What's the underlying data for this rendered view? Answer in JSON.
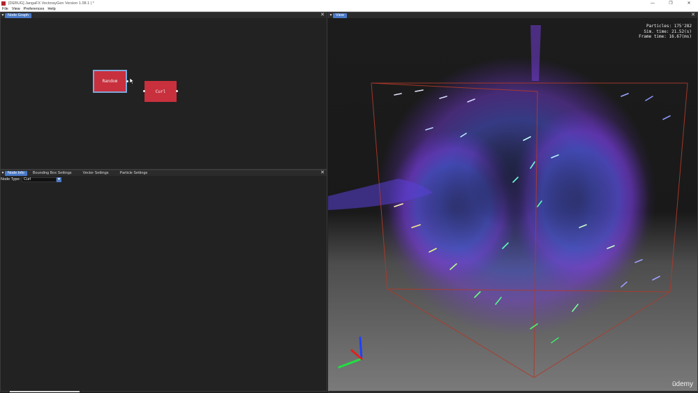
{
  "window": {
    "title": "[DEBUG] JangaFX VectorayGen Version 1.08.1 | *",
    "controls": [
      "—",
      "❐",
      "✕"
    ]
  },
  "menu": [
    "File",
    "View",
    "Preferences",
    "Help"
  ],
  "node_graph": {
    "tab_label": "Node Graph",
    "close": "✕",
    "nodes": {
      "random": "Random",
      "curl": "Curl"
    }
  },
  "bottom_panel": {
    "tabs": [
      "Node Info",
      "Bounding Box Settings",
      "Vector Settings",
      "Particle Settings"
    ],
    "close": "✕",
    "node_type_label": "Node Type:",
    "node_type_value": "Curl",
    "select_arrow": "▼"
  },
  "view": {
    "tab_label": "View",
    "close": "✕",
    "stats": [
      "Particles: 175'282",
      "Sim. time: 21.52(s)",
      "Frame time: 16.67(ms)"
    ],
    "watermark": "ūdemy"
  },
  "colors": {
    "tab_active": "#4a79c6",
    "node_fill": "#c8303d",
    "bounding_box": "#b03a2a",
    "particles_blue": "#4a6cff",
    "particles_purple": "#8a3cf0"
  }
}
